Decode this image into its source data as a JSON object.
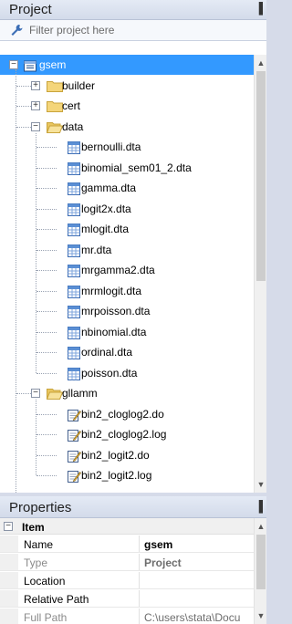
{
  "project_panel": {
    "title": "Project",
    "pin_glyph": "▐",
    "filter_placeholder": "Filter project here",
    "tree": {
      "root": "gsem",
      "folders": [
        {
          "label": "builder",
          "expanded": false
        },
        {
          "label": "cert",
          "expanded": false
        },
        {
          "label": "data",
          "expanded": true,
          "files": [
            "bernoulli.dta",
            "binomial_sem01_2.dta",
            "gamma.dta",
            "logit2x.dta",
            "mlogit.dta",
            "mr.dta",
            "mrgamma2.dta",
            "mrmlogit.dta",
            "mrpoisson.dta",
            "nbinomial.dta",
            "ordinal.dta",
            "poisson.dta"
          ]
        },
        {
          "label": "gllamm",
          "expanded": true,
          "files": [
            "bin2_cloglog2.do",
            "bin2_cloglog2.log",
            "bin2_logit2.do",
            "bin2_logit2.log"
          ]
        }
      ]
    }
  },
  "properties_panel": {
    "title": "Properties",
    "pin_glyph": "▐",
    "group_label": "Item",
    "rows": [
      {
        "name": "Name",
        "value": "gsem",
        "disabled": false,
        "bold": true
      },
      {
        "name": "Type",
        "value": "Project",
        "disabled": true,
        "bold": true
      },
      {
        "name": "Location",
        "value": "",
        "disabled": false,
        "bold": false
      },
      {
        "name": "Relative Path",
        "value": "",
        "disabled": false,
        "bold": false
      },
      {
        "name": "Full Path",
        "value": "C:\\users\\stata\\Docu",
        "disabled": true,
        "bold": false
      }
    ]
  },
  "icons": {
    "filter": "wrench-icon",
    "root": "project-icon",
    "folder": "folder-icon",
    "dta": "data-file-icon",
    "do": "do-file-icon",
    "log": "log-file-icon"
  },
  "colors": {
    "selection": "#3399ff",
    "panel_header": "#d3dbea",
    "folder_yellow": "#f4d57a"
  }
}
